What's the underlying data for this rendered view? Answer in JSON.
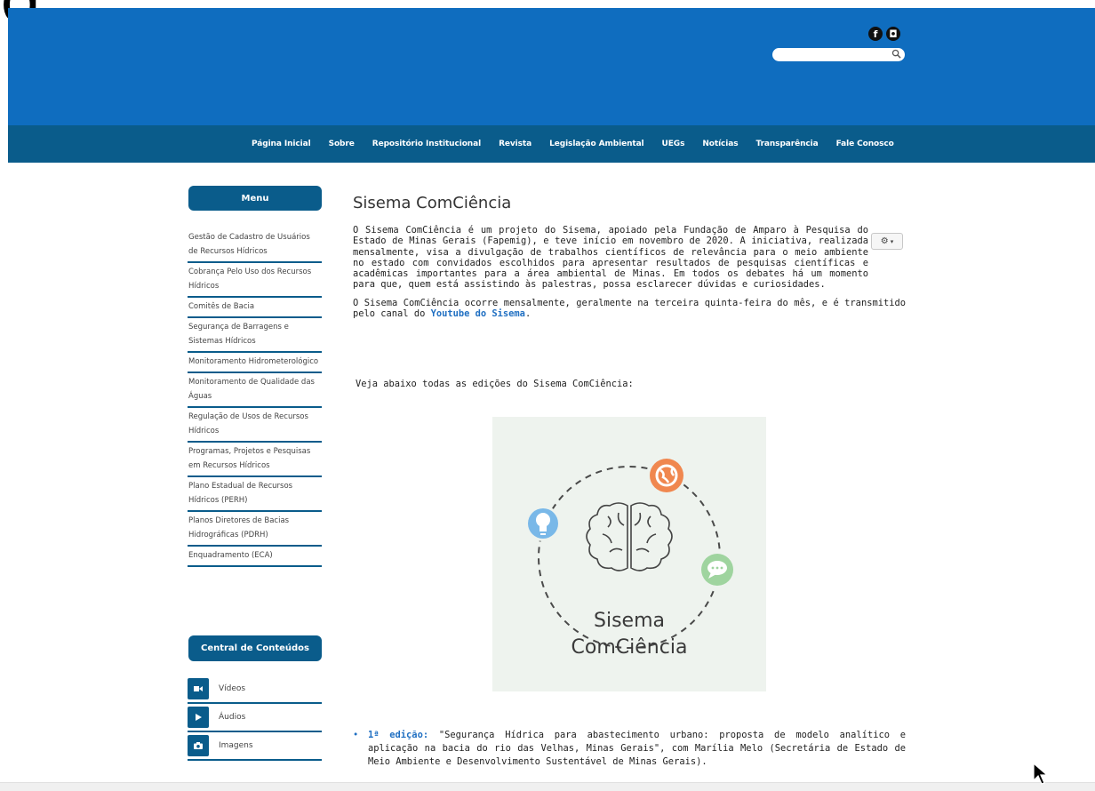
{
  "header": {
    "corner_glyph": "g",
    "social": [
      {
        "icon": "facebook-icon",
        "glyph": "f"
      },
      {
        "icon": "instagram-icon",
        "glyph": "◘"
      }
    ],
    "search": {
      "placeholder": "",
      "value": ""
    }
  },
  "nav": {
    "items": [
      "Página Inicial",
      "Sobre",
      "Repositório Institucional",
      "Revista",
      "Legislação Ambiental",
      "UEGs",
      "Notícias",
      "Transparência",
      "Fale Conosco"
    ]
  },
  "sidebar": {
    "menu_title": "Menu",
    "menu_items": [
      "Gestão de Cadastro de Usuários de Recursos Hídricos",
      "Cobrança Pelo Uso dos Recursos Hídricos",
      "Comitês de Bacia",
      "Segurança de Barragens e Sistemas Hídricos",
      "Monitoramento Hidrometerológico",
      "Monitoramento de Qualidade das Águas",
      "Regulação de Usos de Recursos Hídricos",
      "Programas, Projetos e Pesquisas em Recursos Hídricos",
      "Plano Estadual de Recursos Hídricos (PERH)",
      "Planos Diretores de Bacias Hidrográficas (PDRH)",
      "Enquadramento (ECA)"
    ],
    "content_title": "Central de Conteúdos",
    "content_items": [
      {
        "label": "Vídeos",
        "icon": "video-camera-icon"
      },
      {
        "label": "Áudios",
        "icon": "play-icon"
      },
      {
        "label": "Imagens",
        "icon": "camera-icon"
      }
    ]
  },
  "main": {
    "title": "Sisema ComCiência",
    "para1": "O Sisema ComCiência é um projeto do Sisema, apoiado pela Fundação de Amparo à Pesquisa do Estado de Minas Gerais (Fapemig), e teve início em novembro de 2020. A iniciativa, realizada mensalmente, visa a divulgação de trabalhos científicos de relevância para o meio ambiente no estado com convidados escolhidos para apresentar resultados de pesquisas científicas e acadêmicas importantes para a área ambiental de Minas. Em todos os debates há um momento para que, quem está assistindo às palestras, possa esclarecer dúvidas e curiosidades.",
    "para2_before": "O Sisema ComCiência ocorre mensalmente, geralmente na terceira quinta-feira do mês, e é transmitido pelo canal do ",
    "para2_link": "Youtube do Sisema",
    "para2_after": ".",
    "intro": "Veja abaixo todas as edições do Sisema ComCiência:",
    "logo_text_line1": "Sisema",
    "logo_text_line2": "ComCiência",
    "edition1_label": "1ª edição:",
    "edition1_text": " \"Segurança Hídrica para abastecimento urbano: proposta de modelo analítico e aplicação na bacia do rio das Velhas, Minas Gerais\", com Marília Melo (Secretária de Estado de Meio Ambiente e Desenvolvimento Sustentável de Minas Gerais)."
  },
  "colors": {
    "header_blue": "#0f6dbf",
    "nav_blue": "#0a5c8b",
    "link_blue": "#1f6fc2",
    "orange": "#f0874f",
    "light_blue": "#79b8e8",
    "green": "#9fd49f"
  }
}
